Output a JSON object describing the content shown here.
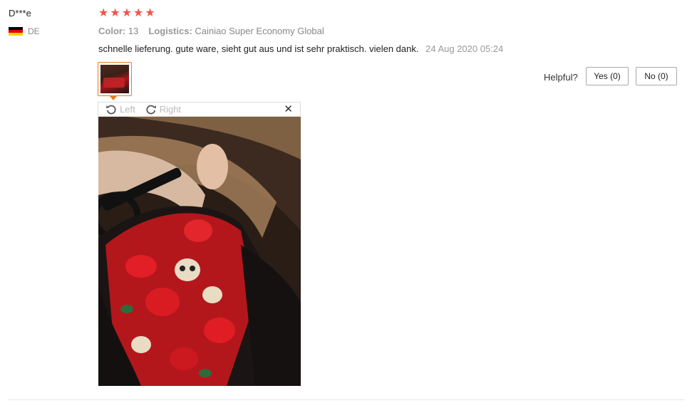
{
  "reviewer": {
    "name": "D***e",
    "country_code": "DE",
    "flag_icon": "germany-flag-icon",
    "flag_colors": [
      "#000000",
      "#dd0000",
      "#ffce00"
    ]
  },
  "rating": {
    "stars": 5,
    "max": 5,
    "star_color": "#f2544a"
  },
  "attributes": {
    "color_label": "Color:",
    "color_value": "13",
    "logistics_label": "Logistics:",
    "logistics_value": "Cainiao Super Economy Global"
  },
  "review": {
    "text": "schnelle lieferung. gute ware, sieht gut aus und ist sehr praktisch. vielen dank.",
    "date": "24 Aug 2020 05:24"
  },
  "helpful": {
    "label": "Helpful?",
    "yes_label": "Yes (0)",
    "no_label": "No (0)"
  },
  "image_viewer": {
    "rotate_left_label": "Left",
    "rotate_right_label": "Right",
    "rotate_left_icon": "rotate-left-icon",
    "rotate_right_icon": "rotate-right-icon",
    "close_icon": "close-icon",
    "close_glyph": "✕"
  },
  "colors": {
    "accent": "#e67e22"
  }
}
